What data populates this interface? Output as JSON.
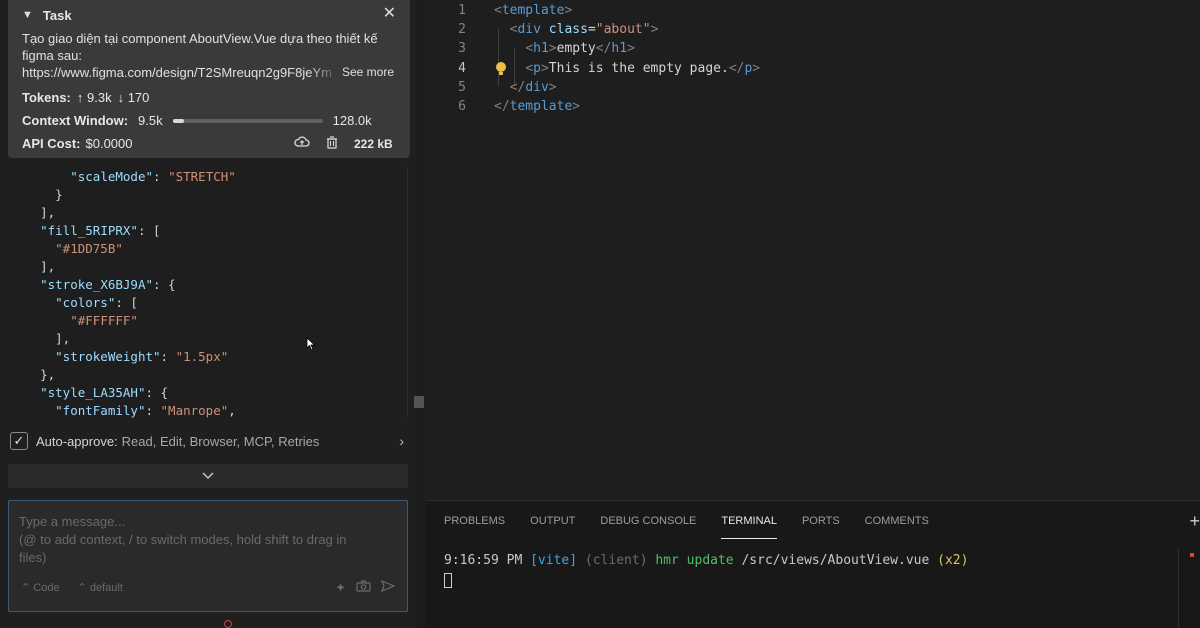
{
  "task": {
    "header": "Task",
    "text_line1": "Tạo giao diện tại component AboutView.Vue dựa theo thiết kế",
    "text_line2": "figma sau:",
    "url": "https://www.figma.com/design/T2SMreuqn2g9F8jeYm",
    "see_more": "See more",
    "tokens_label": "Tokens:",
    "tokens_up": "↑ 9.3k",
    "tokens_down": "↓ 170",
    "context_label": "Context Window:",
    "context_used": "9.5k",
    "context_max": "128.0k",
    "context_fraction": 0.074,
    "cost_label": "API Cost:",
    "cost_value": "$0.0000",
    "size": "222 kB"
  },
  "json_lines": [
    {
      "indent": "        ",
      "parts": [
        [
          "k",
          "\"scaleMode\""
        ],
        [
          "p",
          ": "
        ],
        [
          "s",
          "\"STRETCH\""
        ]
      ]
    },
    {
      "indent": "      ",
      "parts": [
        [
          "p",
          "}"
        ]
      ]
    },
    {
      "indent": "    ",
      "parts": [
        [
          "p",
          "],"
        ]
      ]
    },
    {
      "indent": "    ",
      "parts": [
        [
          "k",
          "\"fill_5RIPRX\""
        ],
        [
          "p",
          ": ["
        ]
      ]
    },
    {
      "indent": "      ",
      "parts": [
        [
          "s",
          "\"#1DD75B\""
        ]
      ]
    },
    {
      "indent": "    ",
      "parts": [
        [
          "p",
          "],"
        ]
      ]
    },
    {
      "indent": "    ",
      "parts": [
        [
          "k",
          "\"stroke_X6BJ9A\""
        ],
        [
          "p",
          ": {"
        ]
      ]
    },
    {
      "indent": "      ",
      "parts": [
        [
          "k",
          "\"colors\""
        ],
        [
          "p",
          ": ["
        ]
      ]
    },
    {
      "indent": "        ",
      "parts": [
        [
          "s",
          "\"#FFFFFF\""
        ]
      ]
    },
    {
      "indent": "      ",
      "parts": [
        [
          "p",
          "],"
        ]
      ]
    },
    {
      "indent": "      ",
      "parts": [
        [
          "k",
          "\"strokeWeight\""
        ],
        [
          "p",
          ": "
        ],
        [
          "s",
          "\"1.5px\""
        ]
      ]
    },
    {
      "indent": "    ",
      "parts": [
        [
          "p",
          "},"
        ]
      ]
    },
    {
      "indent": "    ",
      "parts": [
        [
          "k",
          "\"style_LA35AH\""
        ],
        [
          "p",
          ": {"
        ]
      ]
    },
    {
      "indent": "      ",
      "parts": [
        [
          "k",
          "\"fontFamily\""
        ],
        [
          "p",
          ": "
        ],
        [
          "s",
          "\"Manrope\""
        ],
        [
          "p",
          ","
        ]
      ]
    }
  ],
  "auto_approve": {
    "label": "Auto-approve:",
    "value": "Read, Edit, Browser, MCP, Retries",
    "checked": true
  },
  "message": {
    "placeholder_line1": "Type a message...",
    "placeholder_line2": "(@ to add context, / to switch modes, hold shift to drag in",
    "placeholder_line3": "files)",
    "mode": "Code",
    "profile": "default"
  },
  "editor": {
    "lines": [
      {
        "num": "1",
        "indent": "",
        "parts": [
          [
            "tg",
            "<"
          ],
          [
            "tn",
            "template"
          ],
          [
            "tg",
            ">"
          ]
        ]
      },
      {
        "num": "2",
        "indent": "  ",
        "parts": [
          [
            "tg",
            "<"
          ],
          [
            "tn",
            "div"
          ],
          [
            "tx",
            " "
          ],
          [
            "at",
            "class"
          ],
          [
            "tx",
            "="
          ],
          [
            "av",
            "\"about\""
          ],
          [
            "tg",
            ">"
          ]
        ]
      },
      {
        "num": "3",
        "indent": "    ",
        "parts": [
          [
            "tg",
            "<"
          ],
          [
            "tn",
            "h1"
          ],
          [
            "tg",
            ">"
          ],
          [
            "tx",
            "empty"
          ],
          [
            "tg",
            "</"
          ],
          [
            "tn",
            "h1"
          ],
          [
            "tg",
            ">"
          ]
        ]
      },
      {
        "num": "4",
        "indent": "    ",
        "parts": [
          [
            "tg",
            "<"
          ],
          [
            "tn",
            "p"
          ],
          [
            "tg",
            ">"
          ],
          [
            "tx",
            "This is the empty page."
          ],
          [
            "tg",
            "</"
          ],
          [
            "tn",
            "p"
          ],
          [
            "tg",
            ">"
          ]
        ]
      },
      {
        "num": "5",
        "indent": "  ",
        "parts": [
          [
            "tg",
            "</"
          ],
          [
            "tn",
            "div"
          ],
          [
            "tg",
            ">"
          ]
        ]
      },
      {
        "num": "6",
        "indent": "",
        "parts": [
          [
            "tg",
            "</"
          ],
          [
            "tn",
            "template"
          ],
          [
            "tg",
            ">"
          ]
        ]
      }
    ],
    "current_line": "4"
  },
  "panel": {
    "tabs": [
      "PROBLEMS",
      "OUTPUT",
      "DEBUG CONSOLE",
      "TERMINAL",
      "PORTS",
      "COMMENTS"
    ],
    "active_tab": "TERMINAL",
    "terminal": {
      "time": "9:16:59 PM",
      "tag": "[vite]",
      "client": "(client)",
      "action": "hmr update",
      "path": "/src/views/AboutView.vue",
      "count": "(x2)"
    }
  },
  "colors": {
    "json_key": "#9cdcfe",
    "json_string": "#ce9178",
    "vite_blue": "#3ba5e6",
    "hmr_green": "#4fbf6a"
  }
}
